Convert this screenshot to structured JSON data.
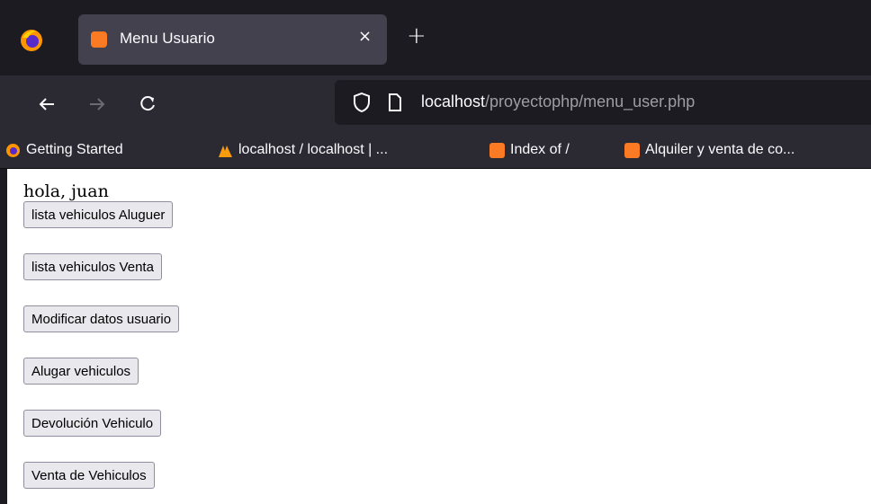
{
  "browser": {
    "tab": {
      "title": "Menu Usuario",
      "close_glyph": "×"
    },
    "new_tab_glyph": "+",
    "nav": {
      "back_glyph": "←",
      "forward_glyph": "→",
      "reload_glyph": "C"
    },
    "url": {
      "host": "localhost",
      "path": "/proyectophp/menu_user.php"
    },
    "bookmarks": [
      {
        "label": "Getting Started",
        "icon": "firefox-icon"
      },
      {
        "label": "localhost / localhost | ...",
        "icon": "phpmyadmin-icon"
      },
      {
        "label": "Index of /",
        "icon": "xampp-icon"
      },
      {
        "label": "Alquiler y venta de co...",
        "icon": "xampp-icon"
      }
    ]
  },
  "page": {
    "greeting": "hola, juan",
    "buttons": [
      "lista vehiculos Aluguer",
      "lista vehiculos Venta",
      "Modificar datos usuario",
      "Alugar vehiculos",
      "Devolución Vehiculo",
      "Venta de Vehiculos"
    ]
  },
  "colors": {
    "accent": "#fb7a24",
    "chrome_dark": "#1c1b22",
    "chrome_mid": "#2b2a33",
    "tab_active": "#42414d"
  }
}
